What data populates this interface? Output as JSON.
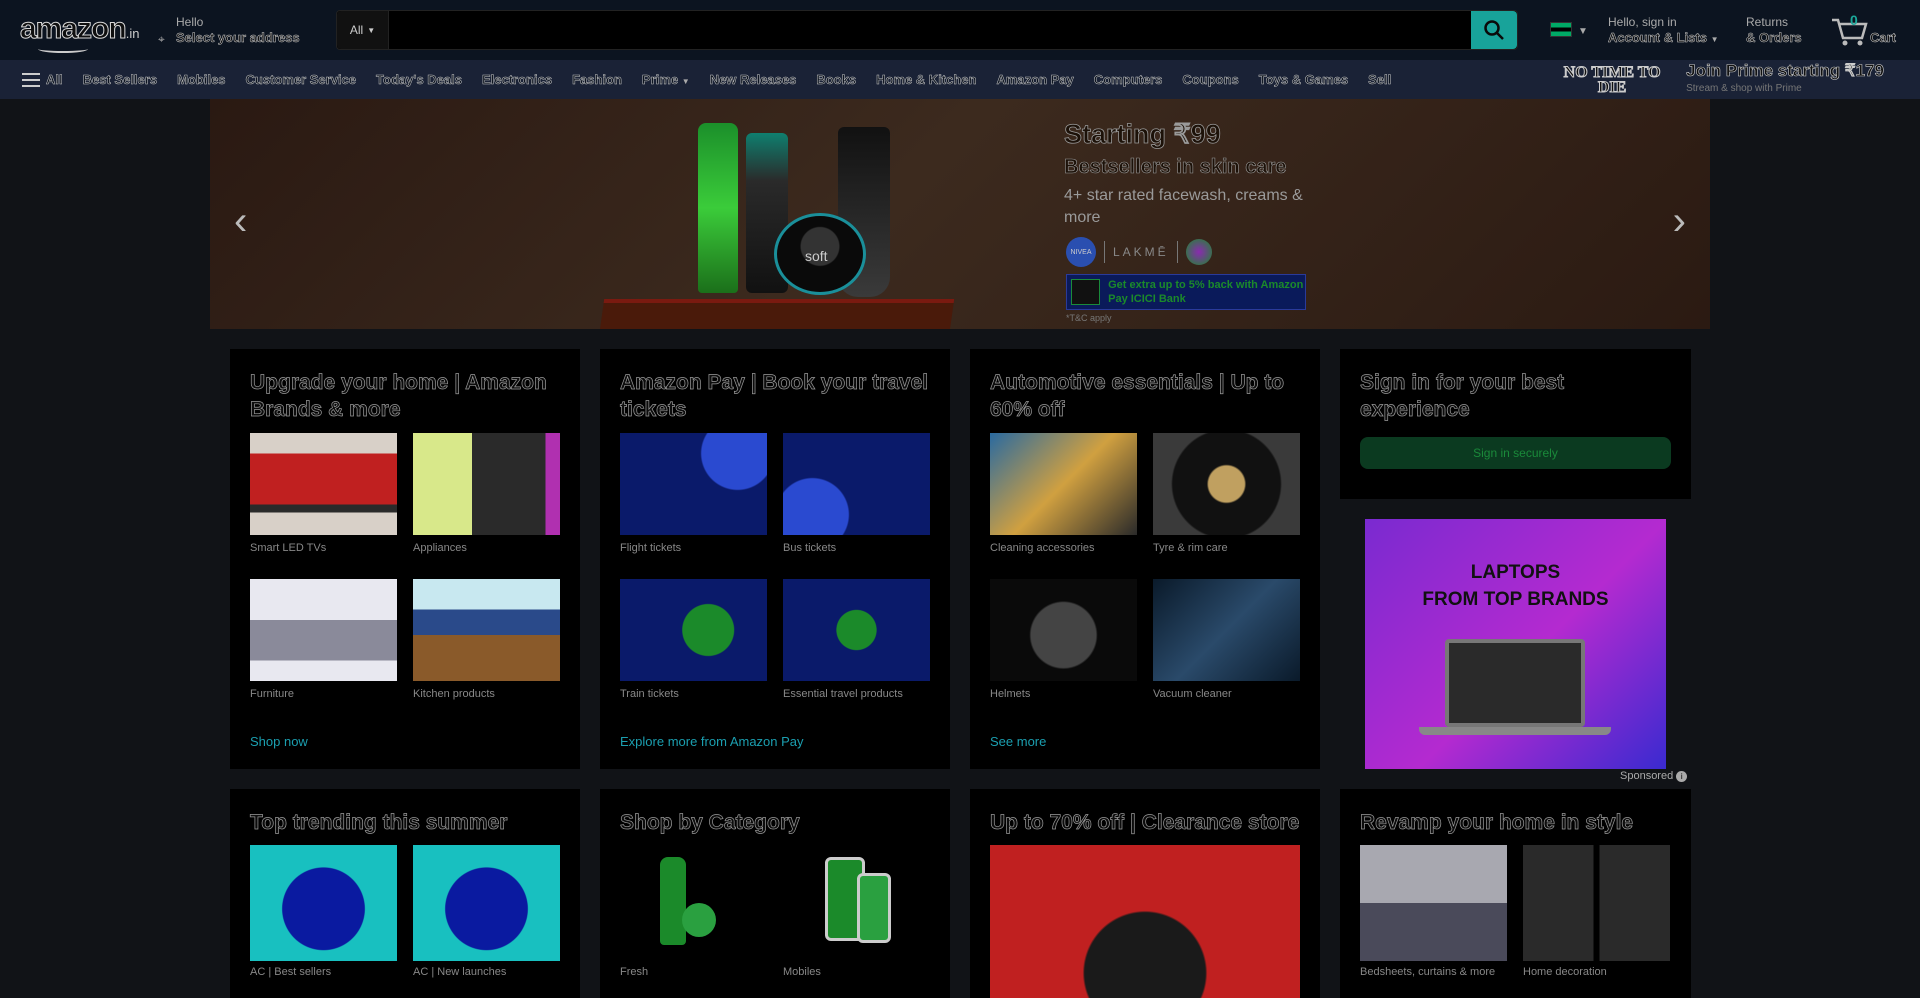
{
  "header": {
    "logo": "amazon",
    "logo_tld": ".in",
    "deliver_line1": "Hello",
    "deliver_line2": "Select your address",
    "search_category": "All",
    "search_placeholder": "",
    "account_line1": "Hello, sign in",
    "account_line2": "Account & Lists",
    "orders_line1": "Returns",
    "orders_line2": "& Orders",
    "cart_count": "0",
    "cart_label": "Cart",
    "icons": {
      "location": "location-pin-icon",
      "search": "search-icon",
      "cart": "cart-icon",
      "flag": "india-flag-icon"
    }
  },
  "subnav": {
    "items": [
      "All",
      "Best Sellers",
      "Mobiles",
      "Customer Service",
      "Today's Deals",
      "Electronics",
      "Fashion",
      "Prime",
      "New Releases",
      "Books",
      "Home & Kitchen",
      "Amazon Pay",
      "Computers",
      "Coupons",
      "Toys & Games",
      "Sell"
    ],
    "promo_left": "NO TIME TO DIE",
    "promo_right": "Join Prime starting ₹179",
    "promo_sub": "Stream & shop with Prime"
  },
  "hero": {
    "h1": "Starting ₹99",
    "h2": "Bestsellers in skin care",
    "h3": "4+ star rated facewash, creams & more",
    "brand1": "NIVEA",
    "brand2": "LAKMĒ",
    "jar_label": "soft",
    "bank_offer": "Get extra up to 5% back with Amazon Pay ICICI Bank",
    "tc": "*T&C apply"
  },
  "cards": [
    {
      "title": "Upgrade your home | Amazon Brands & more",
      "tiles": [
        "Smart LED TVs",
        "Appliances",
        "Furniture",
        "Kitchen products"
      ],
      "link": "Shop now"
    },
    {
      "title": "Amazon Pay | Book your travel tickets",
      "tiles": [
        "Flight tickets",
        "Bus tickets",
        "Train tickets",
        "Essential travel products"
      ],
      "link": "Explore more from Amazon Pay"
    },
    {
      "title": "Automotive essentials | Up to 60% off",
      "tiles": [
        "Cleaning accessories",
        "Tyre & rim care",
        "Helmets",
        "Vacuum cleaner"
      ],
      "link": "See more"
    }
  ],
  "signin": {
    "title": "Sign in for your best experience",
    "button": "Sign in securely"
  },
  "ad": {
    "text_line1": "LAPTOPS",
    "text_line2": "FROM TOP BRANDS",
    "sponsored": "Sponsored"
  },
  "bottom_cards": [
    {
      "title": "Top trending this summer",
      "tiles": [
        "AC | Best sellers",
        "AC | New launches"
      ]
    },
    {
      "title": "Shop by Category",
      "tiles": [
        "Fresh",
        "Mobiles"
      ]
    },
    {
      "title": "Up to 70% off | Clearance store",
      "tiles": []
    },
    {
      "title": "Revamp your home in style",
      "tiles": [
        "Bedsheets, curtains & more",
        "Home decoration"
      ]
    }
  ]
}
